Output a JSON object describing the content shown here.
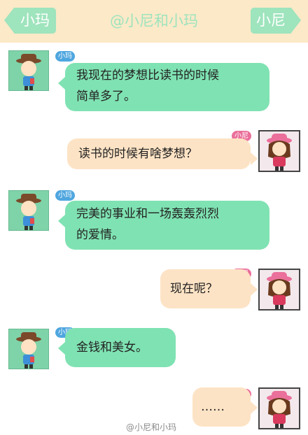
{
  "header": {
    "back_label": "小玛",
    "title": "@小尼和小玛",
    "right_label": "小尼"
  },
  "messages": [
    {
      "sender": "小玛",
      "text_line1": "我现在的梦想比读书的时候",
      "text_line2": "简单多了。"
    },
    {
      "sender": "小尼",
      "text": "读书的时候有啥梦想？"
    },
    {
      "sender": "小玛",
      "text_line1": "完美的事业和一场轰轰烈烈",
      "text_line2": "的爱情。"
    },
    {
      "sender": "小尼",
      "text": "现在呢？"
    },
    {
      "sender": "小玛",
      "text": "金钱和美女。"
    },
    {
      "sender": "小尼",
      "text": "……"
    }
  ],
  "watermark": "@小尼和小玛",
  "colors": {
    "header_bg": "#fbe9c8",
    "accent_green": "#9ee4bd",
    "ma_bubble": "#7fe2b2",
    "ni_bubble": "#fde3c5"
  },
  "icons": {
    "ma_avatar": "boy-with-hat-avatar-icon",
    "ni_avatar": "girl-with-pink-hat-avatar-icon"
  }
}
